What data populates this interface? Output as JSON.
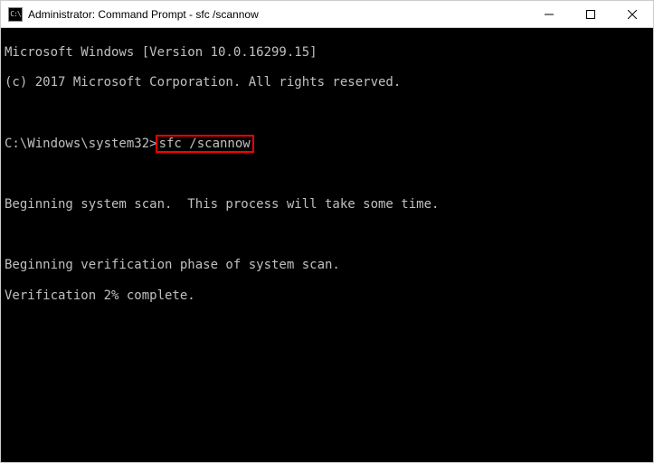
{
  "window": {
    "icon_text": "C:\\",
    "title": "Administrator: Command Prompt - sfc  /scannow"
  },
  "terminal": {
    "version_line": "Microsoft Windows [Version 10.0.16299.15]",
    "copyright_line": "(c) 2017 Microsoft Corporation. All rights reserved.",
    "prompt_path": "C:\\Windows\\system32>",
    "command": "sfc /scannow",
    "scan_begin": "Beginning system scan.  This process will take some time.",
    "verification_phase": "Beginning verification phase of system scan.",
    "verification_progress": "Verification 2% complete."
  }
}
